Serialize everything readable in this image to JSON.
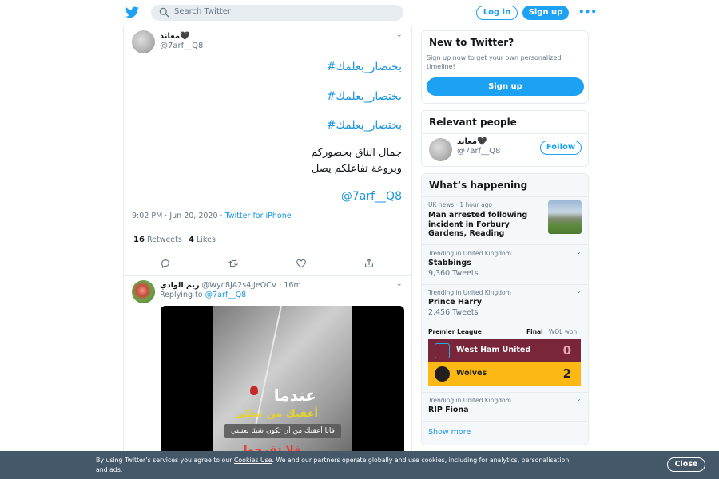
{
  "header": {
    "search_placeholder": "Search Twitter",
    "login_label": "Log in",
    "signup_label": "Sign up",
    "more_label": "•••"
  },
  "tweet": {
    "author_name": "معاند🖤",
    "author_handle": "@7arf__Q8",
    "hashtag_1": "#بختصار_بعلمك",
    "hashtag_2": "#بختصار_بعلمك",
    "hashtag_3": "#بختصار_بعلمك",
    "line_1": "جمال الناق بحضوركم",
    "line_2": "وبروعة تفاعلكم يصل",
    "mention": "@7arf__Q8",
    "time": "9:02 PM · Jun 20, 2020 · ",
    "source": "Twitter for iPhone",
    "retweets_count": "16",
    "retweets_label": "Retweets",
    "likes_count": "4",
    "likes_label": "Likes"
  },
  "reply": {
    "author_name": "ريم الوادي",
    "author_handle": "@Wyc8JA2s4JJeOCV",
    "age": "· 16m",
    "replying_to_label": "Replying to ",
    "replying_to_handle": "@7arf__Q8",
    "media_text_1": "عندما",
    "media_text_2": "أعقبك من تحكي",
    "media_caption": "فانا أعقبك من أن تكون شيئا يعنيني",
    "media_text_4": "فلا تفرحوا ..."
  },
  "sidebar": {
    "new_title": "New to Twitter?",
    "new_desc": "Sign up now to get your own personalized timeline!",
    "new_signup": "Sign up",
    "relevant_title": "Relevant people",
    "relevant_name": "معاند🖤",
    "relevant_handle": "@7arf__Q8",
    "follow_label": "Follow",
    "happening_title": "What’s happening",
    "news_meta": "UK news · 1 hour ago",
    "news_title": "Man arrested following incident in Forbury Gardens, Reading",
    "trends": [
      {
        "meta": "Trending in United Kingdom",
        "title": "Stabbings",
        "count": "9,360 Tweets"
      },
      {
        "meta": "Trending in United Kingdom",
        "title": "Prince Harry",
        "count": "2,456 Tweets"
      },
      {
        "meta": "Trending in United Kingdom",
        "title": "RIP Fiona",
        "count": ""
      }
    ],
    "match_league": "Premier League",
    "match_status_final": "Final",
    "match_status_rest": " · WOL won",
    "team_1": "West Ham United",
    "score_1": "0",
    "team_2": "Wolves",
    "score_2": "2",
    "show_more": "Show more"
  },
  "cookie": {
    "text_before": "By using Twitter’s services you agree to our ",
    "link": "Cookies Use",
    "text_after": ". We and our partners operate globally and use cookies, including for analytics, personalisation, and ads.",
    "close_label": "Close"
  },
  "colors": {
    "brand": "#1da1f2",
    "link": "#1b95e0",
    "west_ham": "#7a263a",
    "wolves": "#fdb913",
    "cookie_bg": "#45586a"
  }
}
